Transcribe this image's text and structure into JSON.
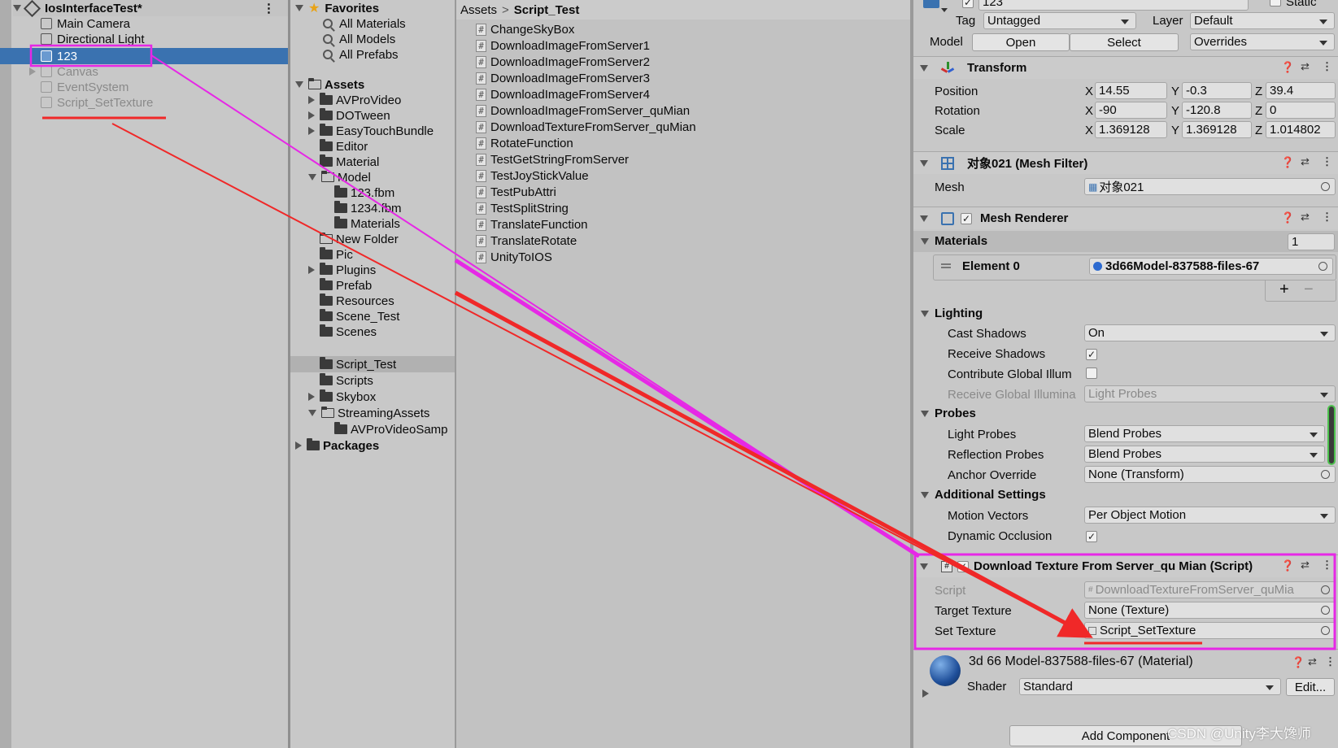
{
  "hierarchy": {
    "scene_name": "IosInterfaceTest*",
    "items": [
      {
        "label": "Main Camera"
      },
      {
        "label": "Directional Light"
      },
      {
        "label": "123"
      },
      {
        "label": "Canvas"
      },
      {
        "label": "EventSystem"
      },
      {
        "label": "Script_SetTexture"
      }
    ]
  },
  "project": {
    "favorites": {
      "label": "Favorites",
      "items": [
        "All Materials",
        "All Models",
        "All Prefabs"
      ]
    },
    "assets_label": "Assets",
    "folders": [
      "AVProVideo",
      "DOTween",
      "EasyTouchBundle",
      "Editor",
      "Material",
      "Model",
      "123.fbm",
      "1234.fbm",
      "Materials",
      "New Folder",
      "Pic",
      "Plugins",
      "Prefab",
      "Resources",
      "Scene_Test",
      "Scenes",
      "Script_Test",
      "Scripts",
      "Skybox",
      "StreamingAssets",
      "AVProVideoSamp"
    ],
    "packages_label": "Packages"
  },
  "assets": {
    "breadcrumb": {
      "root": "Assets",
      "separator": ">",
      "current": "Script_Test"
    },
    "files": [
      "ChangeSkyBox",
      "DownloadImageFromServer1",
      "DownloadImageFromServer2",
      "DownloadImageFromServer3",
      "DownloadImageFromServer4",
      "DownloadImageFromServer_quMian",
      "DownloadTextureFromServer_quMian",
      "RotateFunction",
      "TestGetStringFromServer",
      "TestJoyStickValue",
      "TestPubAttri",
      "TestSplitString",
      "TranslateFunction",
      "TranslateRotate",
      "UnityToIOS"
    ]
  },
  "inspector": {
    "name_value": "123",
    "static_label": "Static",
    "tag_label": "Tag",
    "tag_value": "Untagged",
    "layer_label": "Layer",
    "layer_value": "Default",
    "model_label": "Model",
    "open_button": "Open",
    "select_button": "Select",
    "overrides_value": "Overrides",
    "transform": {
      "title": "Transform",
      "position_label": "Position",
      "rotation_label": "Rotation",
      "scale_label": "Scale",
      "axis_x": "X",
      "axis_y": "Y",
      "axis_z": "Z",
      "position": [
        "14.55",
        "-0.3",
        "39.4"
      ],
      "rotation": [
        "-90",
        "-120.8",
        "0"
      ],
      "scale": [
        "1.369128",
        "1.369128",
        "1.014802"
      ]
    },
    "mesh_filter": {
      "title": "对象021 (Mesh Filter)",
      "mesh_label": "Mesh",
      "mesh_value": "对象021"
    },
    "mesh_renderer": {
      "title": "Mesh Renderer",
      "materials_label": "Materials",
      "materials_count": "1",
      "element_label": "Element 0",
      "element_value": "3d66Model-837588-files-67",
      "plus": "+",
      "minus": "−",
      "lighting_label": "Lighting",
      "cast_shadows_label": "Cast Shadows",
      "cast_shadows_value": "On",
      "receive_shadows_label": "Receive Shadows",
      "contribute_gi_label": "Contribute Global Illum",
      "receive_gi_label": "Receive Global Illumina",
      "receive_gi_value": "Light Probes",
      "probes_label": "Probes",
      "light_probes_label": "Light Probes",
      "light_probes_value": "Blend Probes",
      "reflection_probes_label": "Reflection Probes",
      "reflection_probes_value": "Blend Probes",
      "anchor_override_label": "Anchor Override",
      "anchor_override_value": "None (Transform)",
      "additional_label": "Additional Settings",
      "motion_vectors_label": "Motion Vectors",
      "motion_vectors_value": "Per Object Motion",
      "dynamic_occlusion_label": "Dynamic Occlusion"
    },
    "script_component": {
      "title": "Download Texture From Server_qu Mian (Script)",
      "script_label": "Script",
      "script_value": "DownloadTextureFromServer_quMia",
      "target_texture_label": "Target Texture",
      "target_texture_value": "None (Texture)",
      "set_texture_label": "Set Texture",
      "set_texture_value": "Script_SetTexture"
    },
    "material": {
      "title": "3d 66 Model-837588-files-67 (Material)",
      "shader_label": "Shader",
      "shader_value": "Standard",
      "edit_button": "Edit..."
    },
    "add_component": "Add Component",
    "watermark": "CSDN @Unity李大馋师"
  },
  "colors": {
    "selection": "#3a72b0",
    "highlight_magenta": "#e628e6",
    "arrow_red": "#f02828"
  }
}
